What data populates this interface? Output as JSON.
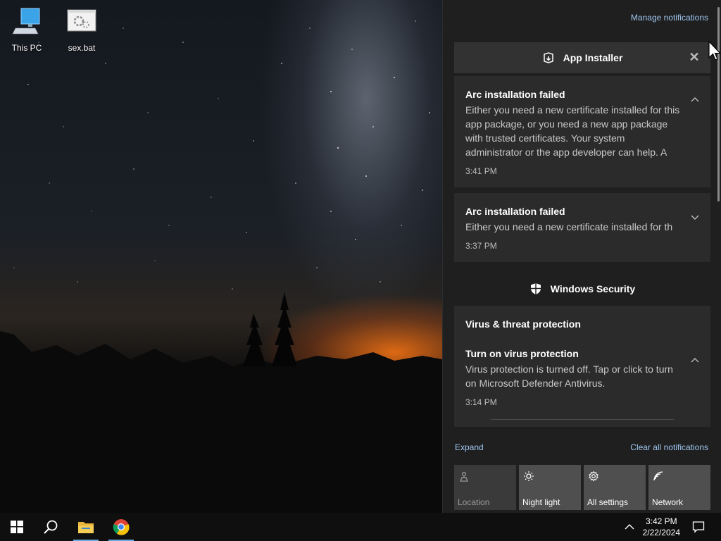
{
  "desktop": {
    "icons": [
      {
        "label": "This PC",
        "icon": "computer-icon"
      },
      {
        "label": "sex.bat",
        "icon": "batch-file-icon"
      }
    ]
  },
  "action_center": {
    "manage_label": "Manage notifications",
    "app_installer": {
      "header": "App Installer",
      "notifications": [
        {
          "title": "Arc installation failed",
          "body": "Either you need a new certificate installed for this app package, or you need a new app package with trusted certificates. Your system administrator or the app developer can help. A",
          "time": "3:41 PM",
          "expanded": true
        },
        {
          "title": "Arc installation failed",
          "body": "Either you need a new certificate installed for th",
          "time": "3:37 PM",
          "expanded": false
        }
      ]
    },
    "windows_security": {
      "header": "Windows Security",
      "section_title": "Virus & threat protection",
      "notification": {
        "title": "Turn on virus protection",
        "body": "Virus protection is turned off. Tap or click to turn on Microsoft Defender Antivirus.",
        "time": "3:14 PM"
      }
    },
    "expand_label": "Expand",
    "clear_label": "Clear all notifications",
    "quick_actions": [
      {
        "label": "Location",
        "icon": "location-icon",
        "enabled": false
      },
      {
        "label": "Night light",
        "icon": "night-light-icon",
        "enabled": true
      },
      {
        "label": "All settings",
        "icon": "gear-icon",
        "enabled": true
      },
      {
        "label": "Network",
        "icon": "network-icon",
        "enabled": true
      }
    ]
  },
  "taskbar": {
    "time": "3:42 PM",
    "date": "2/22/2024"
  },
  "colors": {
    "panel": "#1f1f1f",
    "card": "#2b2b2b",
    "link": "#9ec6f0",
    "taskbar": "#0f0f10"
  }
}
